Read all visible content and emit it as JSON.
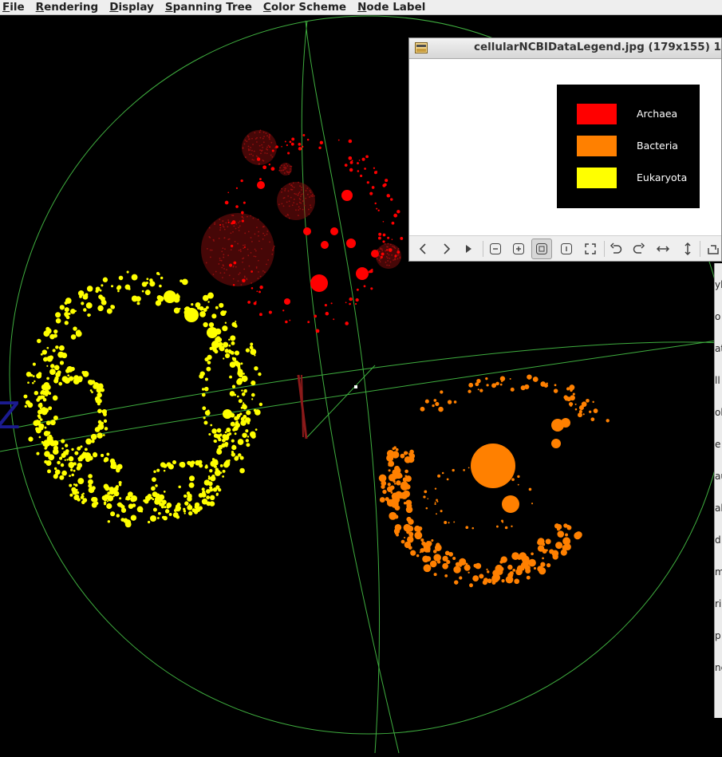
{
  "menubar": {
    "items": [
      {
        "label": "File"
      },
      {
        "label": "Rendering"
      },
      {
        "label": "Display"
      },
      {
        "label": "Spanning Tree"
      },
      {
        "label": "Color Scheme"
      },
      {
        "label": "Node Label"
      }
    ]
  },
  "visualization": {
    "background": "#000000",
    "guide_color": "#3fae3f",
    "axis_label": "Z",
    "axis_label_color": "#1b1b8f",
    "clusters": [
      {
        "name": "Archaea",
        "color": "#ff0000"
      },
      {
        "name": "Bacteria",
        "color": "#ff8000"
      },
      {
        "name": "Eukaryota",
        "color": "#ffff00"
      }
    ]
  },
  "image_viewer": {
    "title": "cellularNCBIDataLegend.jpg (179x155) 1",
    "legend": [
      {
        "label": "Archaea",
        "color": "#ff0000"
      },
      {
        "label": "Bacteria",
        "color": "#ff8000"
      },
      {
        "label": "Eukaryota",
        "color": "#ffff00"
      }
    ],
    "toolbar": {
      "icons": [
        "previous-icon",
        "next-icon",
        "slideshow-icon",
        "zoom-out-icon",
        "zoom-in-icon",
        "zoom-fit-icon",
        "zoom-original-icon",
        "fullscreen-icon",
        "rotate-left-icon",
        "rotate-right-icon",
        "flip-horizontal-icon",
        "flip-vertical-icon",
        "export-icon"
      ]
    }
  },
  "right_panel": {
    "letters": [
      "yl",
      "o",
      "at",
      "ll",
      "ob",
      "e",
      "au",
      "ala",
      "d",
      "m",
      "ri",
      "p",
      "nc"
    ]
  }
}
